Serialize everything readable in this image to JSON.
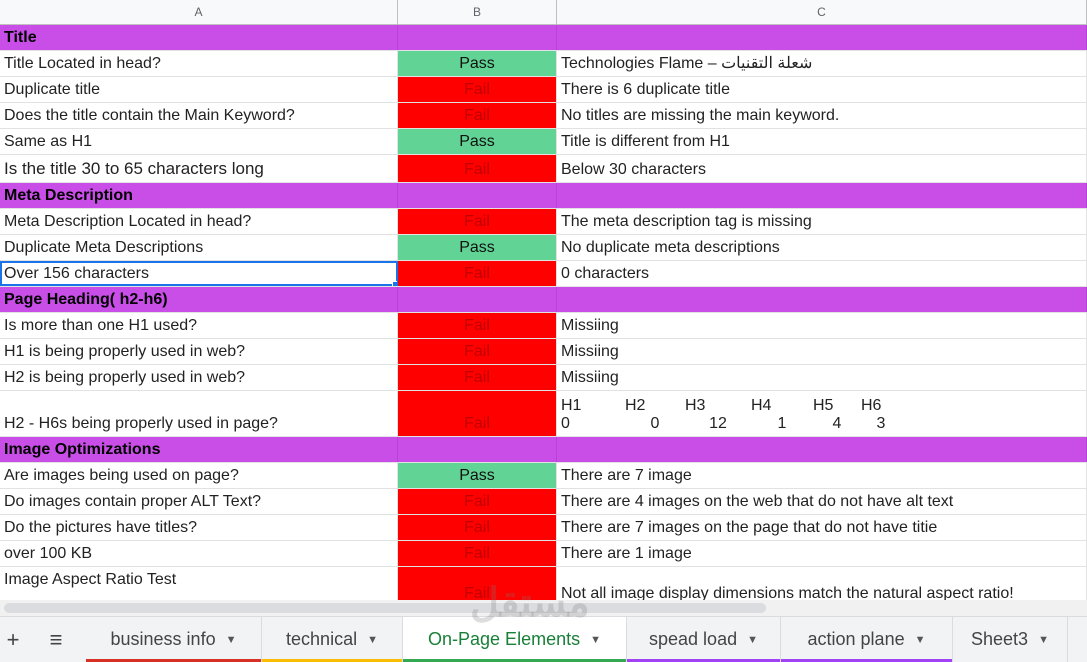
{
  "columns": [
    "A",
    "B",
    "C"
  ],
  "rows": [
    {
      "type": "section",
      "a": "Title"
    },
    {
      "type": "data",
      "a": "Title Located in head?",
      "b": "Pass",
      "c": "Technologies Flame – شعلة التقنيات"
    },
    {
      "type": "data",
      "a": "Duplicate title",
      "b": "Fail",
      "c": "There is 6 duplicate title"
    },
    {
      "type": "data",
      "a": "Does the title contain the Main Keyword?",
      "b": "Fail",
      "c": "No titles are missing the main keyword."
    },
    {
      "type": "data",
      "a": "Same as H1",
      "b": "Pass",
      "c": "Title is different from H1"
    },
    {
      "type": "data",
      "a": "Is the title 30 to 65 characters long",
      "b": "Fail",
      "c": "Below 30 characters"
    },
    {
      "type": "section",
      "a": "Meta Description"
    },
    {
      "type": "data",
      "a": "Meta Description Located in head?",
      "b": "Fail",
      "c": "The meta description tag is missing"
    },
    {
      "type": "data",
      "a": "Duplicate Meta Descriptions",
      "b": "Pass",
      "c": "No duplicate meta descriptions"
    },
    {
      "type": "data",
      "a": "Over 156 characters",
      "b": "Fail",
      "c": "0 characters"
    },
    {
      "type": "section",
      "a": "Page Heading( h2-h6)"
    },
    {
      "type": "data",
      "a": "Is more than one H1 used?",
      "b": "Fail",
      "c": "Missiing"
    },
    {
      "type": "data",
      "a": "H1 is being properly used in web?",
      "b": "Fail",
      "c": "Missiing"
    },
    {
      "type": "data",
      "a": "H2 is being properly used in web?",
      "b": "Fail",
      "c": "Missiing"
    },
    {
      "type": "headings",
      "a": "H2 - H6s being properly used in page?",
      "b": "Fail",
      "labels": [
        "H1",
        "H2",
        "H3",
        "H4",
        "H5",
        "H6"
      ],
      "counts": [
        "0",
        "0",
        "12",
        "1",
        "4",
        "3"
      ]
    },
    {
      "type": "section",
      "a": "Image Optimizations"
    },
    {
      "type": "data",
      "a": "Are images being used on page?",
      "b": "Pass",
      "c": "There are 7 image"
    },
    {
      "type": "data",
      "a": "Do images contain proper ALT Text?",
      "b": "Fail",
      "c": "There are 4 images on the web that do not have alt text"
    },
    {
      "type": "data",
      "a": "Do the pictures have titles?",
      "b": "Fail",
      "c": "There are 7 images on the page that do not have titie"
    },
    {
      "type": "data",
      "a": "over 100 KB",
      "b": "Fail",
      "c": "There are 1 image"
    },
    {
      "type": "data",
      "a": "Image Aspect Ratio Test",
      "b": "Fail",
      "c": "Not all image display dimensions match the natural aspect ratio!"
    }
  ],
  "tabs": [
    {
      "label": "business info",
      "color": "#d93025"
    },
    {
      "label": "technical",
      "color": "#fbbc04"
    },
    {
      "label": "On-Page Elements",
      "color": "#34a853",
      "active": true
    },
    {
      "label": "spead load",
      "color": "#a142f4"
    },
    {
      "label": "action plane",
      "color": "#a142f4"
    },
    {
      "label": "Sheet3",
      "color": ""
    }
  ],
  "colors": {
    "pass": "#61d394",
    "fail": "#ff0000",
    "section": "#c94ee8"
  },
  "watermark": "مستقل"
}
